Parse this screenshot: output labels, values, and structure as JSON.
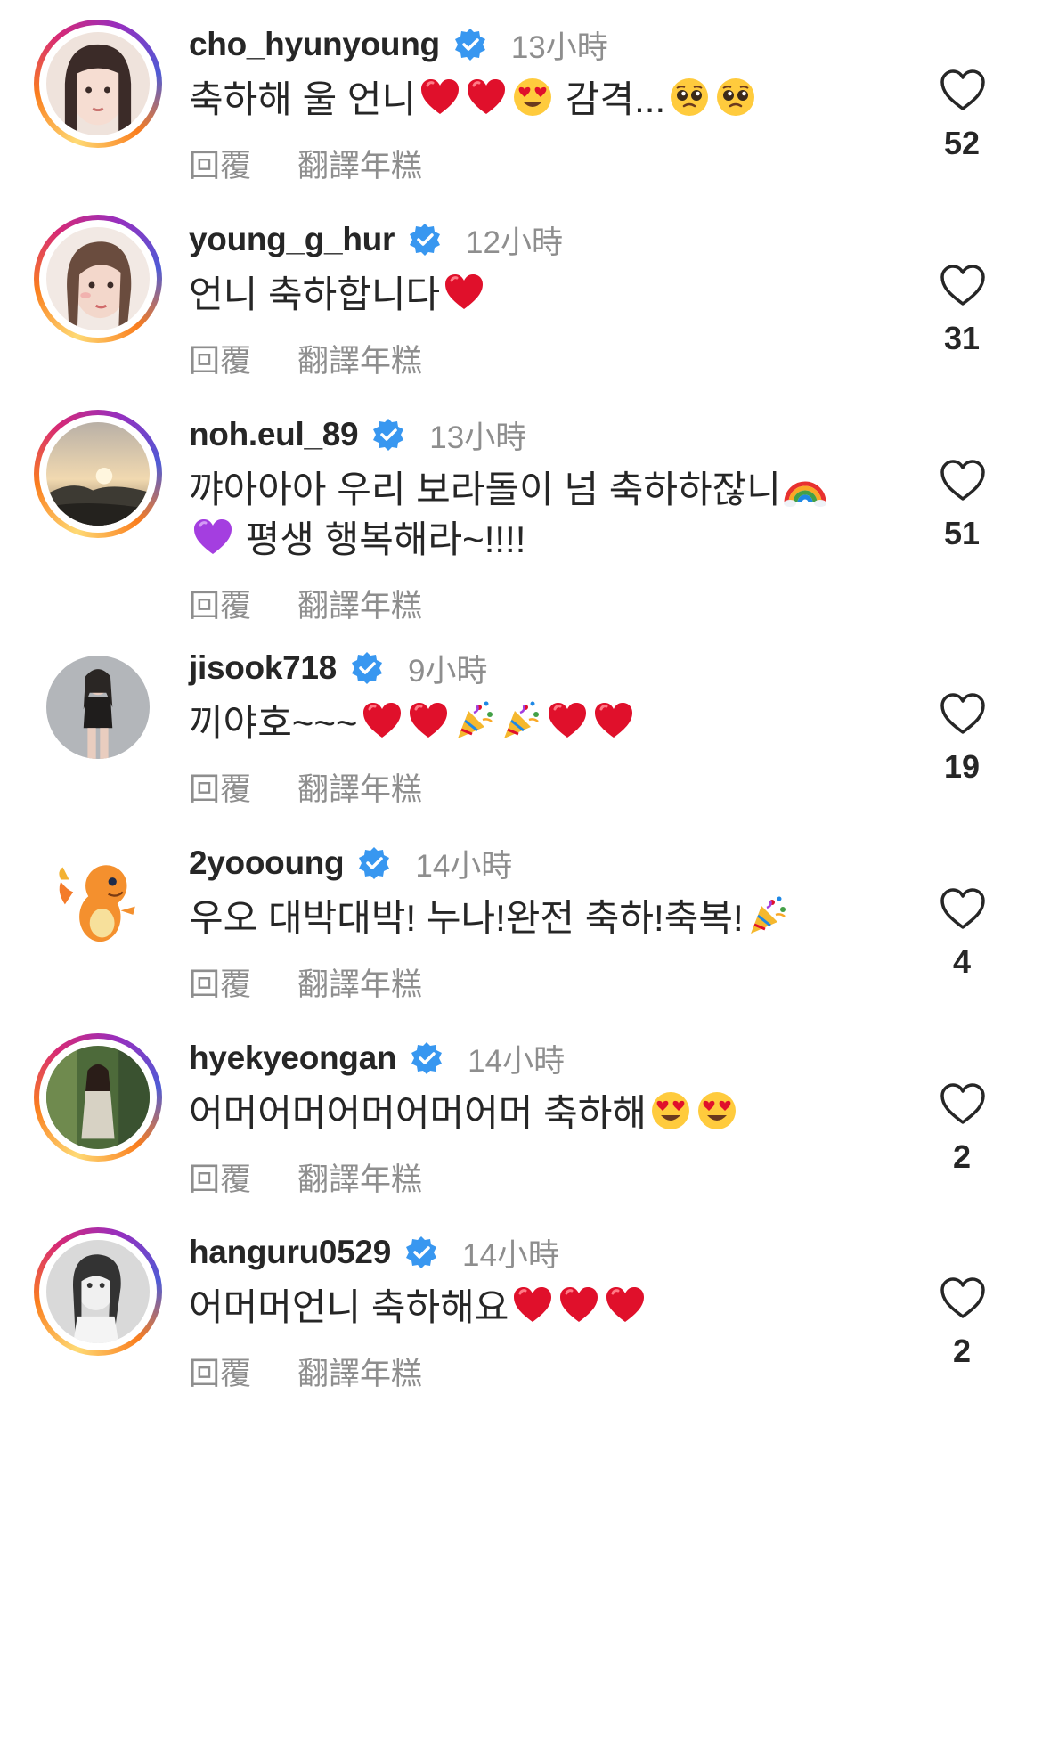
{
  "comments": [
    {
      "username": "cho_hyunyoung",
      "time": "13小時",
      "text_lines": [
        [
          "축하해 울 언니",
          "heart",
          "heart",
          "heart-eyes",
          " 감격...",
          "pleading",
          "pleading"
        ]
      ],
      "reply": "回覆",
      "translate": "翻譯年糕",
      "likes": "52",
      "avatar_style": "story"
    },
    {
      "username": "young_g_hur",
      "time": "12小時",
      "text_lines": [
        [
          "언니 축하합니다",
          "heart"
        ]
      ],
      "reply": "回覆",
      "translate": "翻譯年糕",
      "likes": "31",
      "avatar_style": "story"
    },
    {
      "username": "noh.eul_89",
      "time": "13小時",
      "text_lines": [
        [
          "꺄아아아 우리 보라돌이 넘 축하하잖니",
          "rainbow"
        ],
        [
          "purple-heart",
          " 평생 행복해라~!!!!"
        ]
      ],
      "reply": "回覆",
      "translate": "翻譯年糕",
      "likes": "51",
      "avatar_style": "story"
    },
    {
      "username": "jisook718",
      "time": "9小時",
      "text_lines": [
        [
          "끼야호~~~",
          "heart",
          "heart",
          "party",
          "party",
          "heart",
          "heart"
        ]
      ],
      "reply": "回覆",
      "translate": "翻譯年糕",
      "likes": "19",
      "avatar_style": "plain"
    },
    {
      "username": "2yoooung",
      "time": "14小時",
      "text_lines": [
        [
          "우오 대박대박! 누나!완전 축하!축복!",
          "party"
        ]
      ],
      "reply": "回覆",
      "translate": "翻譯年糕",
      "likes": "4",
      "avatar_style": "plain"
    },
    {
      "username": "hyekyeongan",
      "time": "14小時",
      "text_lines": [
        [
          "어머어머어머어머어머 축하해",
          "heart-eyes",
          "heart-eyes"
        ]
      ],
      "reply": "回覆",
      "translate": "翻譯年糕",
      "likes": "2",
      "avatar_style": "story"
    },
    {
      "username": "hanguru0529",
      "time": "14小時",
      "text_lines": [
        [
          "어머머언니 축하해요",
          "heart",
          "heart",
          "heart"
        ]
      ],
      "reply": "回覆",
      "translate": "翻譯年糕",
      "likes": "2",
      "avatar_style": "story"
    }
  ],
  "icons": {
    "verified": "verified-badge-icon",
    "like": "heart-outline-icon"
  },
  "colors": {
    "verified_blue": "#3897f0",
    "muted_text": "#8e8e8e",
    "primary_text": "#262626"
  }
}
